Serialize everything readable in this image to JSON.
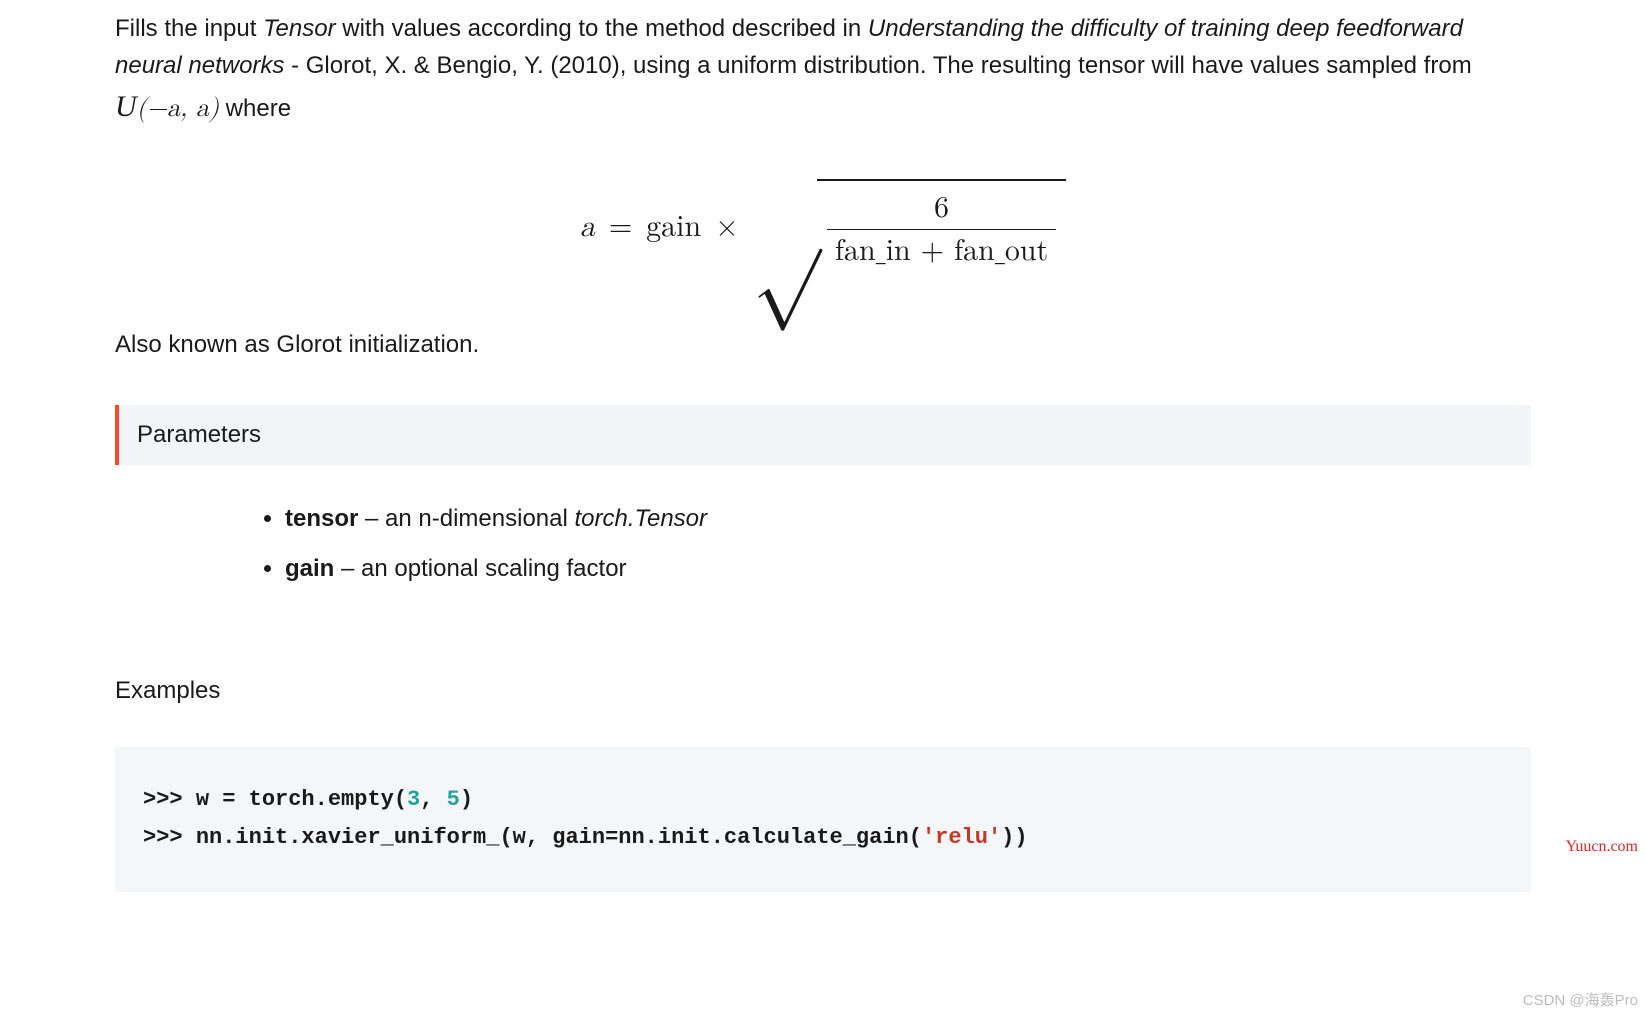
{
  "intro": {
    "pre": "Fills the input ",
    "tensor": "Tensor",
    "mid": " with values according to the method described in ",
    "paper": "Understanding the difficulty of training deep feedforward neural networks",
    "post": " - Glorot, X. & Bengio, Y. (2010), using a uniform distribution. The resulting tensor will have values sampled from ",
    "dist_cal": "U",
    "dist_args": "(−a, a)",
    "tail": " where"
  },
  "formula": {
    "lhs_var": "a",
    "equals": "=",
    "gain": "gain",
    "times": "×",
    "radical": "√",
    "numerator": "6",
    "denominator": "fan_in + fan_out"
  },
  "glorot_note": "Also known as Glorot initialization.",
  "parameters": {
    "heading": "Parameters",
    "items": [
      {
        "name": "tensor",
        "sep": " – ",
        "desc_pre": "an n-dimensional ",
        "desc_em": "torch.Tensor",
        "desc_post": ""
      },
      {
        "name": "gain",
        "sep": " – ",
        "desc_pre": "an optional scaling factor",
        "desc_em": "",
        "desc_post": ""
      }
    ]
  },
  "examples": {
    "heading": "Examples",
    "code": {
      "line1": {
        "prompt": ">>> ",
        "a": "w = torch.empty(",
        "n1": "3",
        "comma": ", ",
        "n2": "5",
        "b": ")"
      },
      "line2": {
        "prompt": ">>> ",
        "a": "nn.init.xavier_uniform_(w, gain=nn.init.calculate_gain(",
        "s": "'relu'",
        "b": "))"
      }
    }
  },
  "watermarks": {
    "right": "Yuucn.com",
    "bottom": "CSDN @海轰Pro"
  }
}
